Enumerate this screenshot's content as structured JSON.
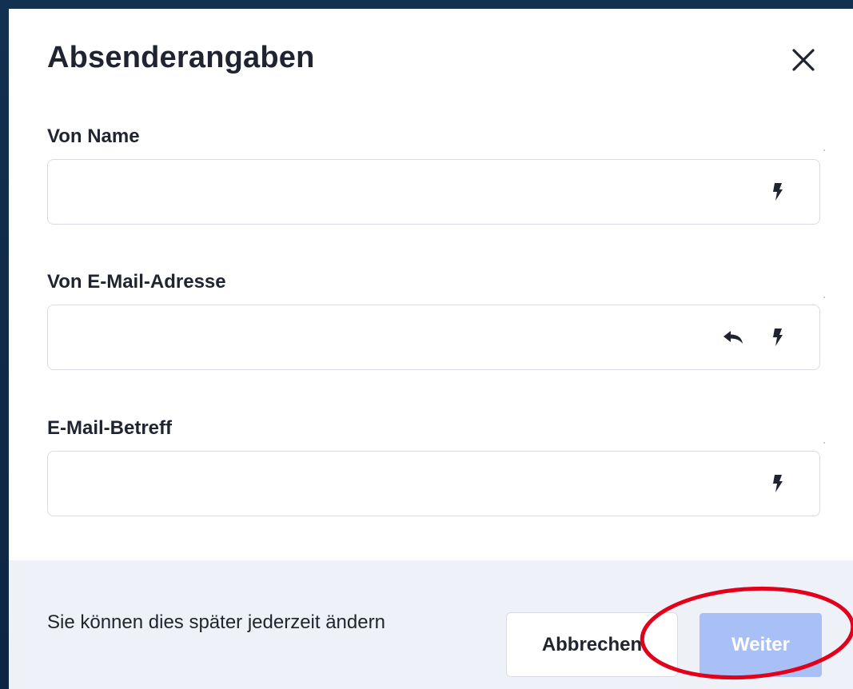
{
  "dialog": {
    "title": "Absenderangaben"
  },
  "fields": [
    {
      "label": "Von Name",
      "value": "",
      "icons": [
        "lightning-icon"
      ]
    },
    {
      "label": "Von E-Mail-Adresse",
      "value": "",
      "icons": [
        "reply-icon",
        "lightning-icon"
      ]
    },
    {
      "label": "E-Mail-Betreff",
      "value": "",
      "icons": [
        "lightning-icon"
      ]
    }
  ],
  "footer": {
    "note": "Sie können dies später jederzeit ändern",
    "cancel_label": "Abbrechen",
    "next_label": "Weiter"
  },
  "colors": {
    "backdrop": "#123050",
    "footer_bg": "#eef1f7",
    "primary_disabled": "#a8c0f5",
    "annotation_red": "#e3001b"
  }
}
